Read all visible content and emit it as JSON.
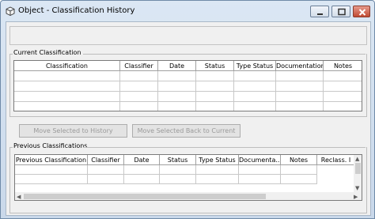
{
  "window": {
    "title": "Object - Classification History",
    "icon": "cube-icon"
  },
  "current": {
    "label": "Current Classification",
    "columns": [
      "Classification",
      "Classifier",
      "Date",
      "Status",
      "Type Status",
      "Documentation",
      "Notes"
    ]
  },
  "buttons": {
    "move_to_history": "Move Selected to History",
    "move_back": "Move Selected Back to Current"
  },
  "previous": {
    "label": "Previous Classifications",
    "columns": [
      "Previous Classification",
      "Classifier",
      "Date",
      "Status",
      "Type Status",
      "Documenta...",
      "Notes",
      "Reclass. I"
    ]
  }
}
